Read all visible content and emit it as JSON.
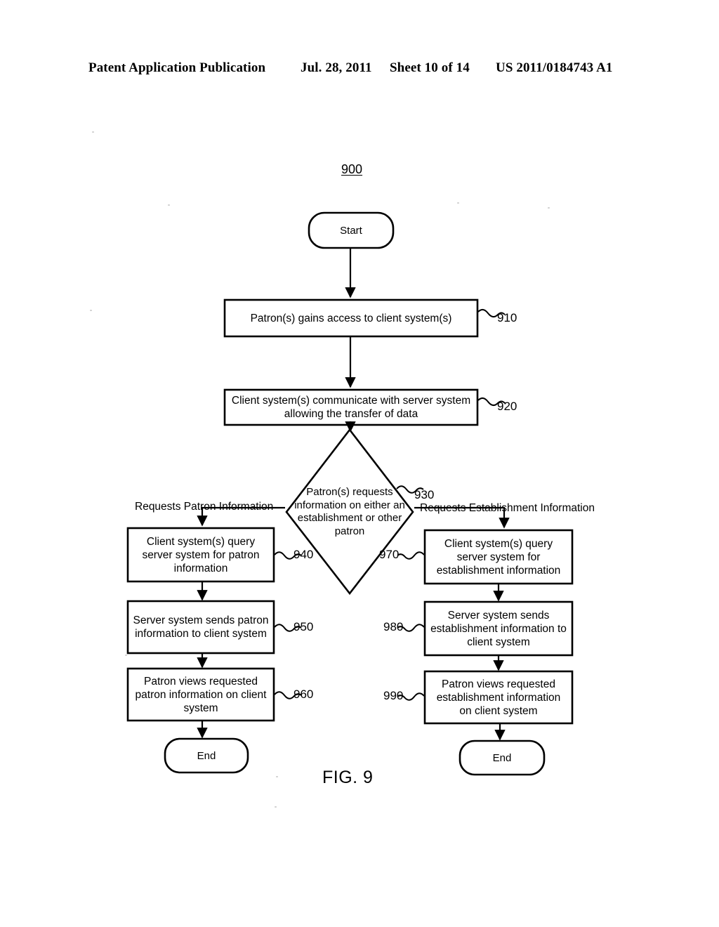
{
  "header": {
    "publication": "Patent Application Publication",
    "date": "Jul. 28, 2011",
    "sheet": "Sheet 10 of 14",
    "patent_number": "US 2011/0184743 A1"
  },
  "figure": {
    "id_label": "900",
    "caption": "FIG. 9"
  },
  "nodes": {
    "start": {
      "label": "Start"
    },
    "step_910": {
      "label": "Patron(s) gains access to client system(s)",
      "ref": "910"
    },
    "step_920": {
      "label": "Client system(s) communicate with server system allowing the transfer of data",
      "ref": "920"
    },
    "decision_930": {
      "label": "Patron(s) requests information on either an establishment or other patron",
      "ref": "930"
    },
    "step_940": {
      "label": "Client system(s) query server system for patron information",
      "ref": "940"
    },
    "step_950": {
      "label": "Server system sends patron information to client system",
      "ref": "950"
    },
    "step_960": {
      "label": "Patron views requested patron information on client system",
      "ref": "960"
    },
    "step_970": {
      "label": "Client system(s) query server system for establishment information",
      "ref": "970"
    },
    "step_980": {
      "label": "Server system sends establishment information to client system",
      "ref": "980"
    },
    "step_990": {
      "label": "Patron views requested establishment information on client system",
      "ref": "990"
    },
    "end_left": {
      "label": "End"
    },
    "end_right": {
      "label": "End"
    }
  },
  "branches": {
    "left": "Requests Patron Information",
    "right": "Requests Establishment Information"
  },
  "colors": {
    "ink": "#000000",
    "paper": "#ffffff"
  }
}
